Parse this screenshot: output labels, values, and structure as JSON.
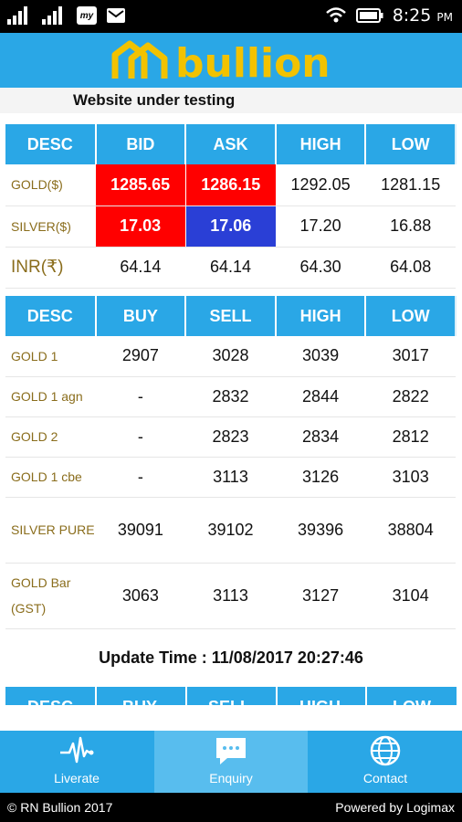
{
  "status_bar": {
    "time": "8:25",
    "ampm": "PM"
  },
  "header": {
    "brand": "bullion",
    "subtitle": "Website under testing"
  },
  "spot_table": {
    "headers": [
      "DESC",
      "BID",
      "ASK",
      "HIGH",
      "LOW"
    ],
    "rows": [
      {
        "desc": "GOLD($)",
        "bid": "1285.65",
        "ask": "1286.15",
        "high": "1292.05",
        "low": "1281.15"
      },
      {
        "desc": "SILVER($)",
        "bid": "17.03",
        "ask": "17.06",
        "high": "17.20",
        "low": "16.88"
      },
      {
        "desc": "INR(₹)",
        "bid": "64.14",
        "ask": "64.14",
        "high": "64.30",
        "low": "64.08"
      }
    ]
  },
  "rate_table": {
    "headers": [
      "DESC",
      "BUY",
      "SELL",
      "HIGH",
      "LOW"
    ],
    "rows": [
      {
        "desc": "GOLD 1",
        "buy": "2907",
        "sell": "3028",
        "high": "3039",
        "low": "3017"
      },
      {
        "desc": "GOLD 1 agn",
        "buy": "-",
        "sell": "2832",
        "high": "2844",
        "low": "2822"
      },
      {
        "desc": "GOLD 2",
        "buy": "-",
        "sell": "2823",
        "high": "2834",
        "low": "2812"
      },
      {
        "desc": "GOLD 1 cbe",
        "buy": "-",
        "sell": "3113",
        "high": "3126",
        "low": "3103"
      },
      {
        "desc": "SILVER PURE",
        "buy": "39091",
        "sell": "39102",
        "high": "39396",
        "low": "38804"
      },
      {
        "desc": "GOLD Bar (GST)",
        "buy": "3063",
        "sell": "3113",
        "high": "3127",
        "low": "3104"
      }
    ]
  },
  "update_time": "Update Time : 11/08/2017 20:27:46",
  "next_table_headers": [
    "DESC",
    "BUY",
    "SELL",
    "HIGH",
    "LOW"
  ],
  "bottom_nav": [
    {
      "label": "Liverate",
      "icon": "pulse-icon"
    },
    {
      "label": "Enquiry",
      "icon": "chat-bubble-icon"
    },
    {
      "label": "Contact",
      "icon": "globe-icon"
    }
  ],
  "footer": {
    "copyright": "© RN Bullion 2017",
    "powered": "Powered by Logimax"
  },
  "colors": {
    "header_blue": "#2aa7e6",
    "bid_red": "#ff0000",
    "ask_blue": "#2a3fd6",
    "desc_gold": "#8a6d1c"
  }
}
